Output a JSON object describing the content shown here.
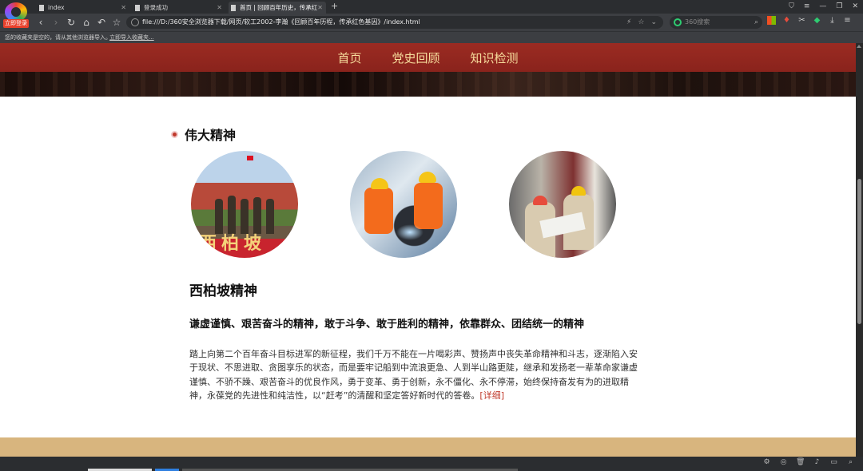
{
  "browser": {
    "logo_badge": "立即登录",
    "tabs": [
      {
        "label": "index"
      },
      {
        "label": "登录成功"
      },
      {
        "label": "首页 | 回顾百年历史，传承红"
      }
    ],
    "new_tab": "+",
    "address_url": "file:///D:/360安全浏览器下载/网页/软工2002-李瀚《回顾百年历程，传承红色基因》/index.html",
    "search_placeholder": "360搜索",
    "bookmark_text": "您的收藏夹是空的，请从其他浏览器导入。",
    "bookmark_import_link": "立即导入收藏夹..."
  },
  "site": {
    "nav": [
      {
        "label": "首页"
      },
      {
        "label": "党史回顾"
      },
      {
        "label": "知识检测"
      }
    ],
    "section_title": "伟大精神",
    "spirit_title": "西柏坡精神",
    "spirit_subtitle": "谦虚谨慎、艰苦奋斗的精神，敢于斗争、敢于胜利的精神，依靠群众、团结统一的精神",
    "spirit_body": "踏上向第二个百年奋斗目标进军的新征程，我们千万不能在一片喝彩声、赞扬声中丧失革命精神和斗志，逐渐陷入安于现状、不思进取、贪图享乐的状态，而是要牢记船到中流浪更急、人到半山路更陡，继承和发扬老一辈革命家谦虚谨慎、不骄不躁、艰苦奋斗的优良作风，勇于变革、勇于创新，永不僵化、永不停滞，始终保持奋发有为的进取精神，永葆党的先进性和纯洁性，以“赶考”的清醒和坚定答好新时代的答卷。",
    "more_link": "[详细]",
    "image1_banner": "西柏坡"
  },
  "colors": {
    "nav_bg": "#8a231c",
    "nav_text": "#f6dc9c",
    "bullet": "#c0392b",
    "link": "#c0392b",
    "footer_band": "#d8b57e"
  }
}
